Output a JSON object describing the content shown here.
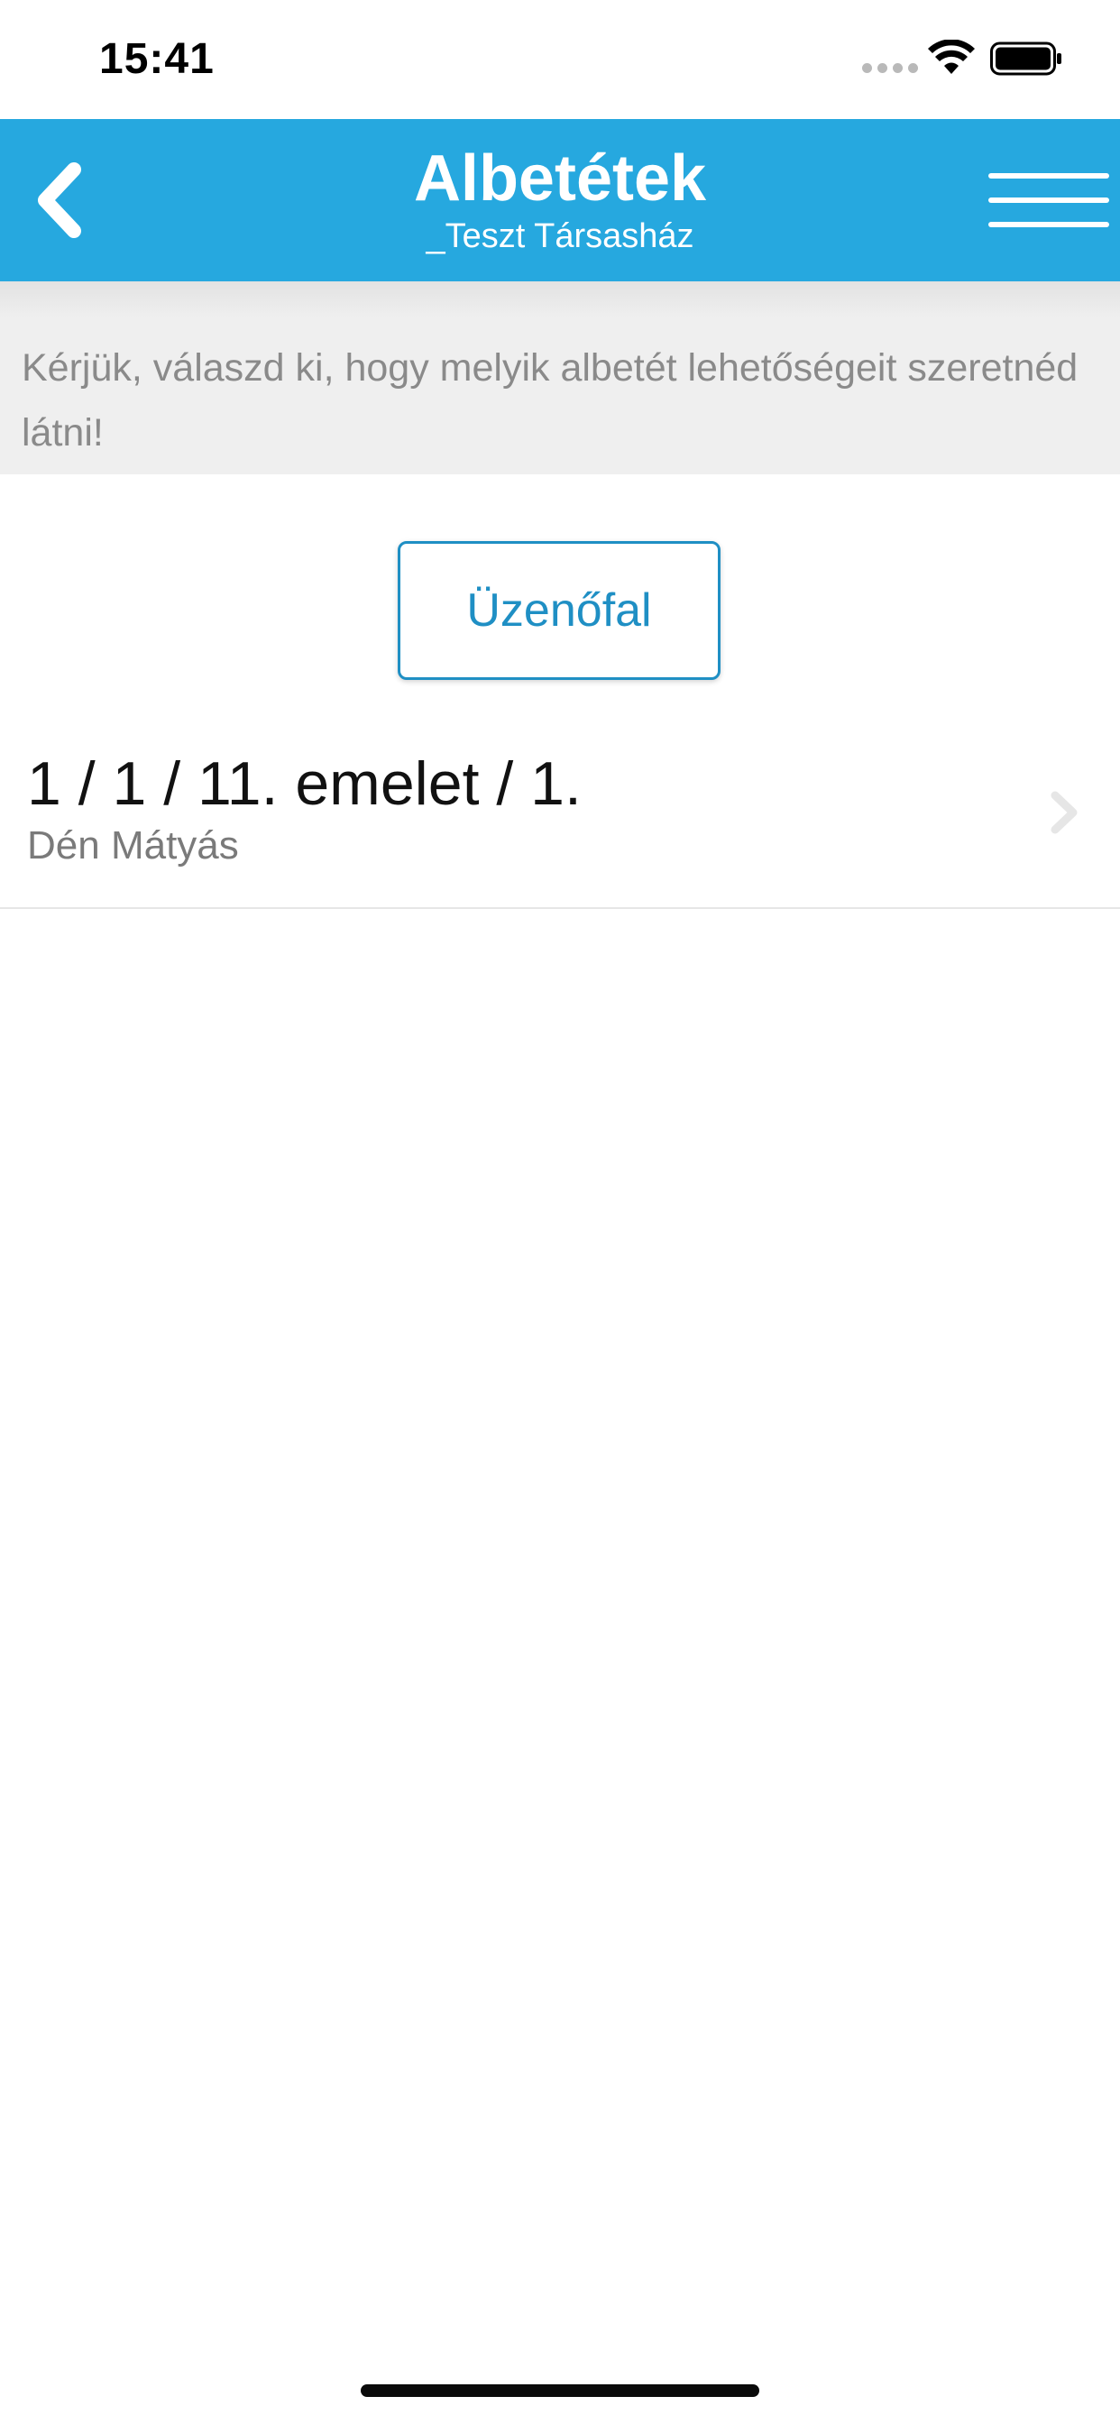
{
  "status_bar": {
    "time": "15:41"
  },
  "header": {
    "title": "Albetétek",
    "subtitle": "_Teszt Társasház",
    "background_color": "#26a8df",
    "back_icon": "chevron-left-icon",
    "menu_icon": "hamburger-menu-icon"
  },
  "instruction": {
    "text": "Kérjük, válaszd ki, hogy melyik albetét lehetőségeit szeretnéd látni!"
  },
  "wall_button": {
    "label": "Üzenőfal",
    "accent_color": "#1f8fc4"
  },
  "units": [
    {
      "title": "1 / 1 / 11. emelet / 1.",
      "owner": "Dén Mátyás"
    }
  ]
}
